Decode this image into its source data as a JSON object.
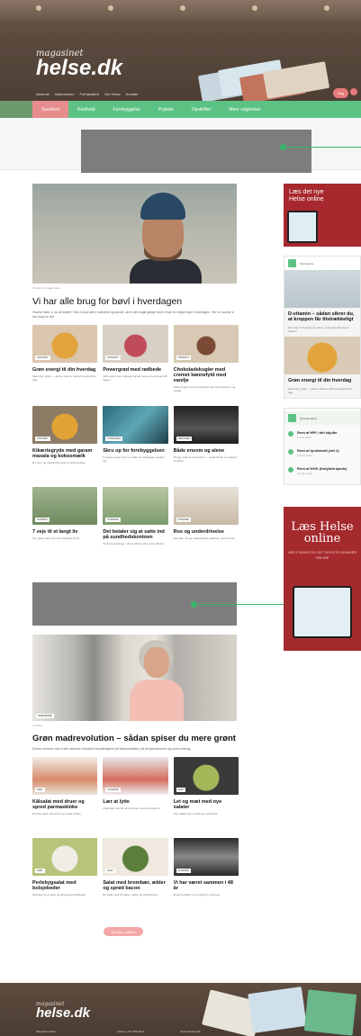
{
  "header": {
    "logo_small": "magasinet",
    "logo": "helse.dk",
    "topnav": [
      "Abonnér",
      "Nyhedsbrev",
      "Forhandlere",
      "Om Helse",
      "Kontakt"
    ],
    "pill_label": "Søg"
  },
  "nav": {
    "tabs": [
      "Sundhed",
      "Kosthold",
      "Forebyggelse",
      "Psykisk",
      "Opskrifter",
      "Mere udgivelser"
    ]
  },
  "feature1": {
    "date": "Af Helse 12 dage siden",
    "title": "Vi har alle brug for bøvl i hverdagen",
    "excerpt": "Hvorfor føler vi os så trætte? Når vi skal være motiveret og sunde, så er det nogle gange fordi vi har for meget bøvl i hverdagen. Her er hvorfor vi har brug for det."
  },
  "grid1": [
    {
      "tag": "OPSKRIFT",
      "title": "Grøn energi til din hverdag",
      "text": "Saml dig i grønt — denne bowl er fuld af energi til din dag."
    },
    {
      "tag": "OPSKRIFT",
      "title": "Powergrød med rødbede",
      "text": "Varm grød med rødbede og bær giver en god start på dagen."
    },
    {
      "tag": "OPSKRIFT",
      "title": "Chokoladekugler med cremet bønnefyld med vanilje",
      "text": "Søde kugler med et overraskende fyld af bønner og vanilje."
    },
    {
      "tag": "OPSKRIFT",
      "title": "Kikærtegryde med garam masala og kokosmælk",
      "text": "En varm og mættende gryde til hele familien."
    },
    {
      "tag": "FORSKNING",
      "title": "Skru op for forebyggelsen",
      "text": "Forskere peger på nye måder at forebygge sygdom på."
    },
    {
      "tag": "MENINGER",
      "title": "Både ensom og alene",
      "text": "Mange oplever ensomhed — også når de er omgivet af andre."
    },
    {
      "tag": "TRÆNING",
      "title": "7 veje til et langt liv",
      "text": "Syv gode vaner der kan forlænge dit liv."
    },
    {
      "tag": "SUNDHED",
      "title": "Det betaler sig at satte ind på sundhedskontoen",
      "text": "Små investeringer i din sundhed giver stort udbytte."
    },
    {
      "tag": "SUNDHED",
      "title": "Ros og underdrivelse",
      "text": "Hvordan ros og underdrivelse påvirker vores trivsel."
    }
  ],
  "feature2": {
    "tag": "OPSKRIFTER",
    "date": "Af Helse",
    "title": "Grøn madrevolution – sådan spiser du mere grønt",
    "excerpt": "Denne sommer har vi alle sammen mindset forandringerne på klimaområdet, på temperaturerne og vores forbrug."
  },
  "grid2": [
    {
      "tag": "DIÆT",
      "title": "Kålsalat med druer og spred parmaskinke",
      "text": "En frisk salat med druer og sprød skinke."
    },
    {
      "tag": "SUNDHED",
      "title": "Lær at lytte",
      "text": "Hvad kan man få ud af at lytte mere til kroppen?"
    },
    {
      "tag": "DIÆT",
      "title": "Let og mæt med nye salater",
      "text": "Nye salater der er lette og mættende."
    },
    {
      "tag": "DIÆT",
      "title": "Perlebygsalat med bolsjebeder",
      "text": "Perlebyg med søde og farverige bolsjebeder."
    },
    {
      "tag": "DIÆT",
      "title": "Salat med brombær, æbler og sprød bacon",
      "text": "En salat med brombær, æbler og sprød bacon."
    },
    {
      "tag": "SUNDHED",
      "title": "Vi har været sammen i 48 år",
      "text": "Et par fortæller om et langt liv sammen."
    }
  ],
  "load_more": "Vis flere artikler",
  "sidebar": {
    "ad1": "Læs det nye Helse online",
    "box_label": "Top historie",
    "box1_title": "D-vitamin – sådan sikrer du, at kroppen får tilstrækkeligt",
    "box1_text": "Her viser vi hvordan du sikrer, at kroppen får nok D-vitamin.",
    "box2_title": "Grøn energi til din hverdag",
    "box2_text": "Saml dig i grønt — denne bowl er fuld af energi til din dag.",
    "list_label": "Nyhedsudbud",
    "list": [
      {
        "title": "Rent af HPI i det skjulte",
        "sub": "1 time siden"
      },
      {
        "title": "Rent af tyndskrafi (del 2)",
        "sub": "2 timer siden"
      },
      {
        "title": "Rent af HOK (fortyldet tjarde)",
        "sub": "3 timer siden"
      }
    ],
    "ad2_big": "Læs Helse online",
    "ad2_small": "HER FINDER DU DET NYESTE NUMMER ONLINE"
  },
  "footer": {
    "logo_small": "magasinet",
    "logo": "helse.dk",
    "col1": "Magasinet Helse",
    "col2": "Telefon +45 7099 9011",
    "col3": "Persondatapolitik"
  },
  "colors": {
    "green": "#5cc283",
    "pink": "#e88d8d",
    "ad_red": "#a52a2e"
  }
}
